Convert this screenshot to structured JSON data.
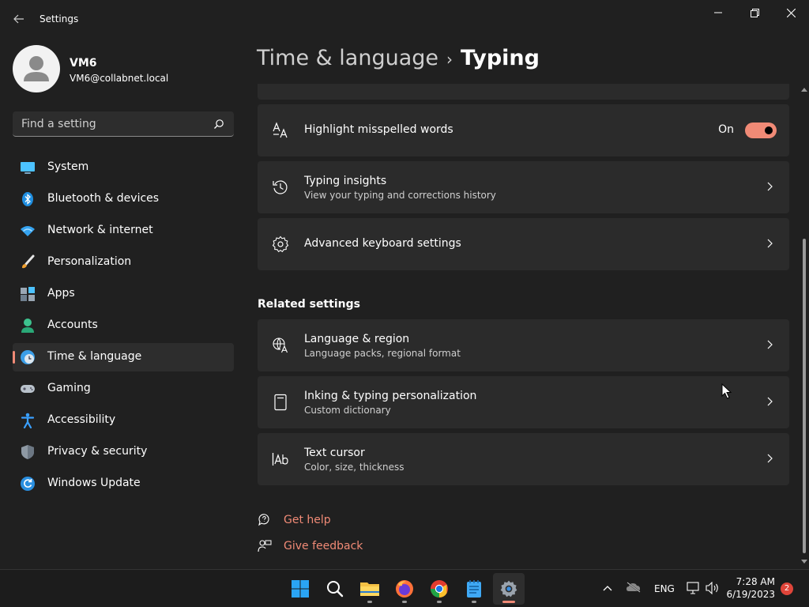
{
  "app": {
    "title": "Settings"
  },
  "user": {
    "name": "VM6",
    "email": "VM6@collabnet.local"
  },
  "search": {
    "placeholder": "Find a setting"
  },
  "nav": [
    {
      "label": "System",
      "icon": "monitor-icon"
    },
    {
      "label": "Bluetooth & devices",
      "icon": "bluetooth-icon"
    },
    {
      "label": "Network & internet",
      "icon": "wifi-icon"
    },
    {
      "label": "Personalization",
      "icon": "brush-icon"
    },
    {
      "label": "Apps",
      "icon": "apps-icon"
    },
    {
      "label": "Accounts",
      "icon": "person-icon"
    },
    {
      "label": "Time & language",
      "icon": "clock-globe-icon",
      "active": true
    },
    {
      "label": "Gaming",
      "icon": "gamepad-icon"
    },
    {
      "label": "Accessibility",
      "icon": "accessibility-icon"
    },
    {
      "label": "Privacy & security",
      "icon": "shield-icon"
    },
    {
      "label": "Windows Update",
      "icon": "update-icon"
    }
  ],
  "breadcrumb": {
    "parent": "Time & language",
    "current": "Typing"
  },
  "settings": {
    "highlight": {
      "title": "Highlight misspelled words",
      "state": "On",
      "enabled": true
    },
    "insights": {
      "title": "Typing insights",
      "subtitle": "View your typing and corrections history"
    },
    "advanced": {
      "title": "Advanced keyboard settings"
    }
  },
  "related": {
    "title": "Related settings",
    "items": [
      {
        "title": "Language & region",
        "subtitle": "Language packs, regional format"
      },
      {
        "title": "Inking & typing personalization",
        "subtitle": "Custom dictionary"
      },
      {
        "title": "Text cursor",
        "subtitle": "Color, size, thickness"
      }
    ]
  },
  "links": {
    "help": "Get help",
    "feedback": "Give feedback"
  },
  "tray": {
    "language": "ENG",
    "time": "7:28 AM",
    "date": "6/19/2023",
    "notifications": "2"
  },
  "colors": {
    "accent": "#f08a76",
    "background": "#202020",
    "card": "#2b2b2b"
  }
}
